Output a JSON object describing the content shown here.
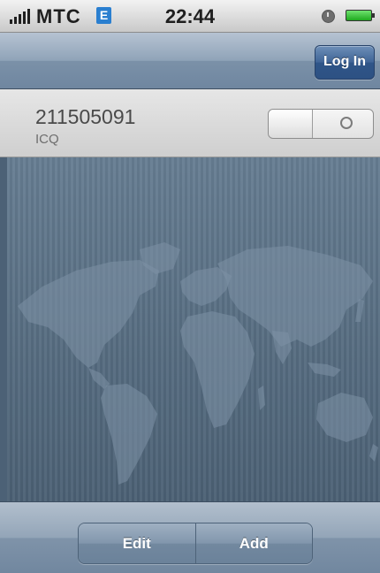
{
  "status_bar": {
    "carrier": "MTC",
    "network_type": "E",
    "time": "22:44"
  },
  "nav_bar": {
    "login_label": "Log In"
  },
  "account": {
    "number": "211505091",
    "service": "ICQ",
    "enabled": false
  },
  "toolbar": {
    "edit_label": "Edit",
    "add_label": "Add"
  },
  "icons": {
    "signal": "signal-bars-icon",
    "network": "edge-network-icon",
    "alarm": "alarm-clock-icon",
    "battery": "battery-icon",
    "background": "world-map-icon"
  },
  "colors": {
    "status_bar": "#d9d9d9",
    "nav_bar": "#8fa3b8",
    "login_button": "#3f6496",
    "content_background": "#5a6f82",
    "toolbar": "#8196ac"
  }
}
